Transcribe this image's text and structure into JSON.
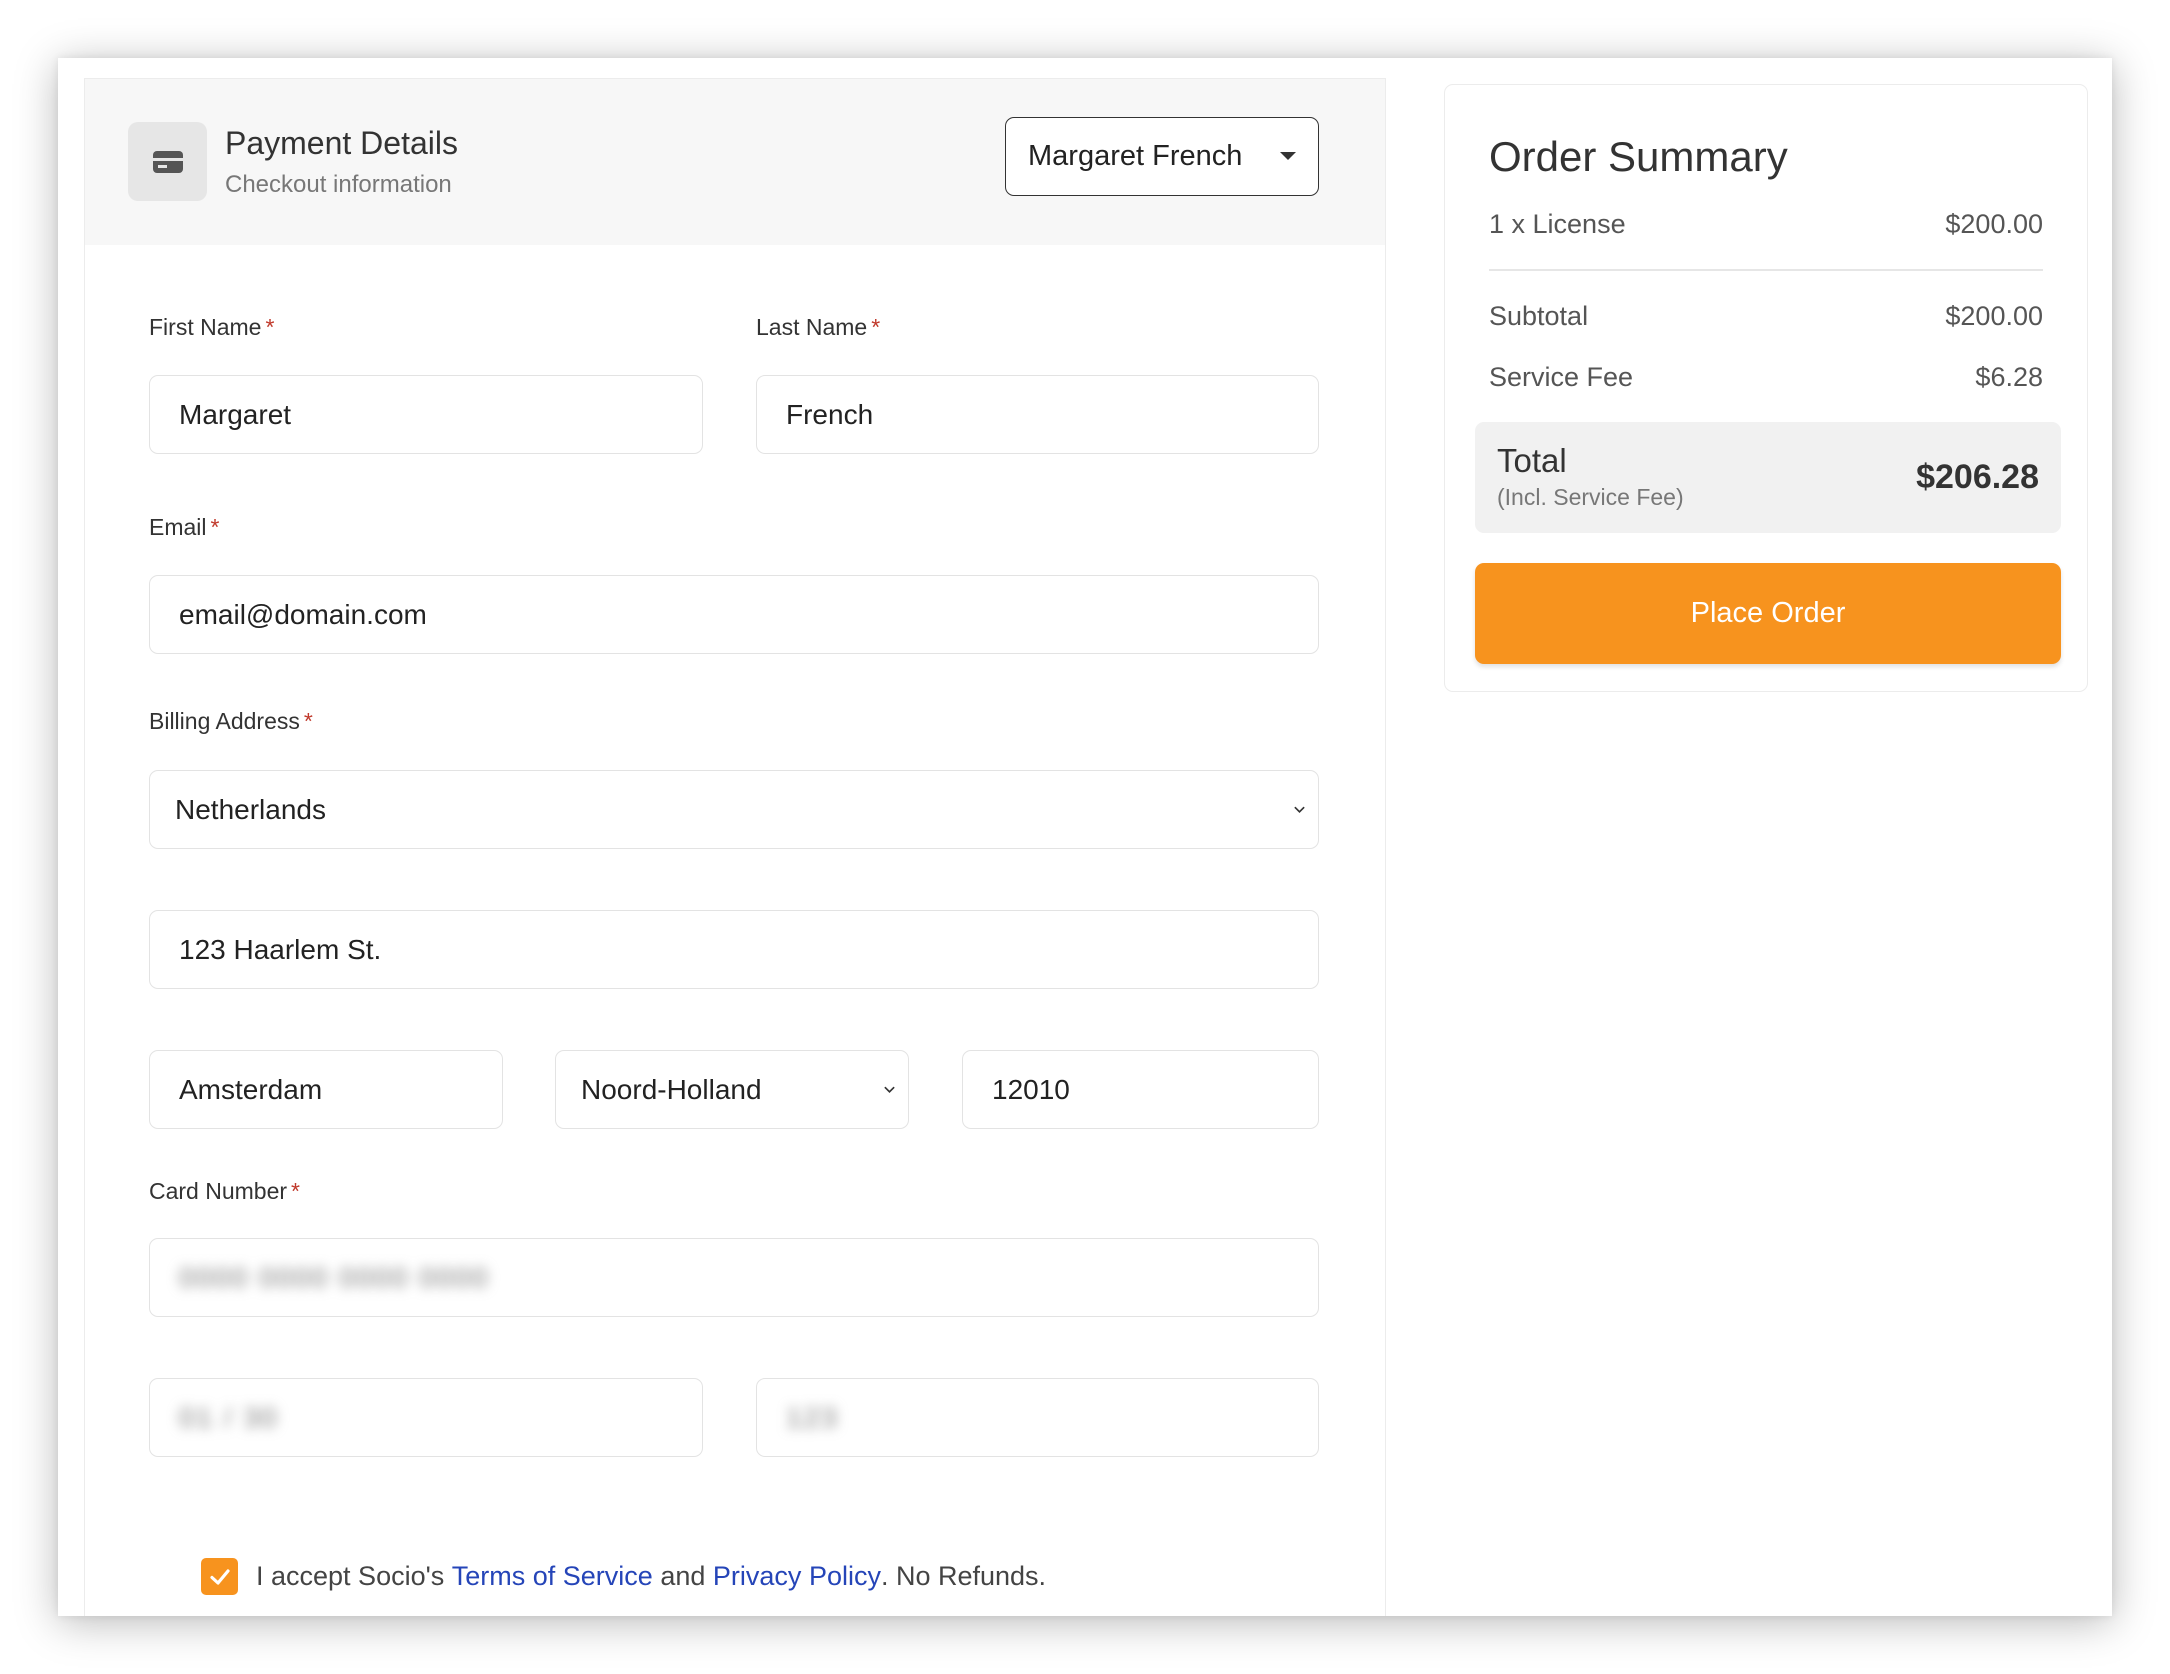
{
  "header": {
    "title": "Payment Details",
    "subtitle": "Checkout information",
    "user_select": "Margaret French"
  },
  "form": {
    "first_name": {
      "label": "First Name",
      "value": "Margaret"
    },
    "last_name": {
      "label": "Last Name",
      "value": "French"
    },
    "email": {
      "label": "Email",
      "value": "email@domain.com"
    },
    "billing": {
      "label": "Billing Address",
      "country": "Netherlands",
      "street": "123 Haarlem St.",
      "city": "Amsterdam",
      "region": "Noord-Holland",
      "postal": "12010"
    },
    "card": {
      "label": "Card Number",
      "number": "0000 0000 0000 0000",
      "expiry": "01 / 30",
      "cvc": "123"
    },
    "required_mark": "*"
  },
  "terms": {
    "prefix": "I accept Socio's",
    "tos_link": "Terms of Service",
    "and": "and",
    "privacy_link": "Privacy Policy",
    "suffix": ". No Refunds.",
    "checked": true
  },
  "summary": {
    "title": "Order Summary",
    "item_label": "1 x License",
    "item_price": "$200.00",
    "subtotal_label": "Subtotal",
    "subtotal_value": "$200.00",
    "fee_label": "Service Fee",
    "fee_value": "$6.28",
    "total_label": "Total",
    "total_sub": "(Incl. Service Fee)",
    "total_value": "$206.28",
    "place_order": "Place Order"
  },
  "colors": {
    "accent": "#f7931e",
    "link": "#2545b8",
    "required": "#c0392b"
  },
  "icons": {
    "header": "credit-card-icon",
    "user_select": "caret-down-icon",
    "select": "chevron-down-icon",
    "checkbox": "checkmark-icon"
  }
}
